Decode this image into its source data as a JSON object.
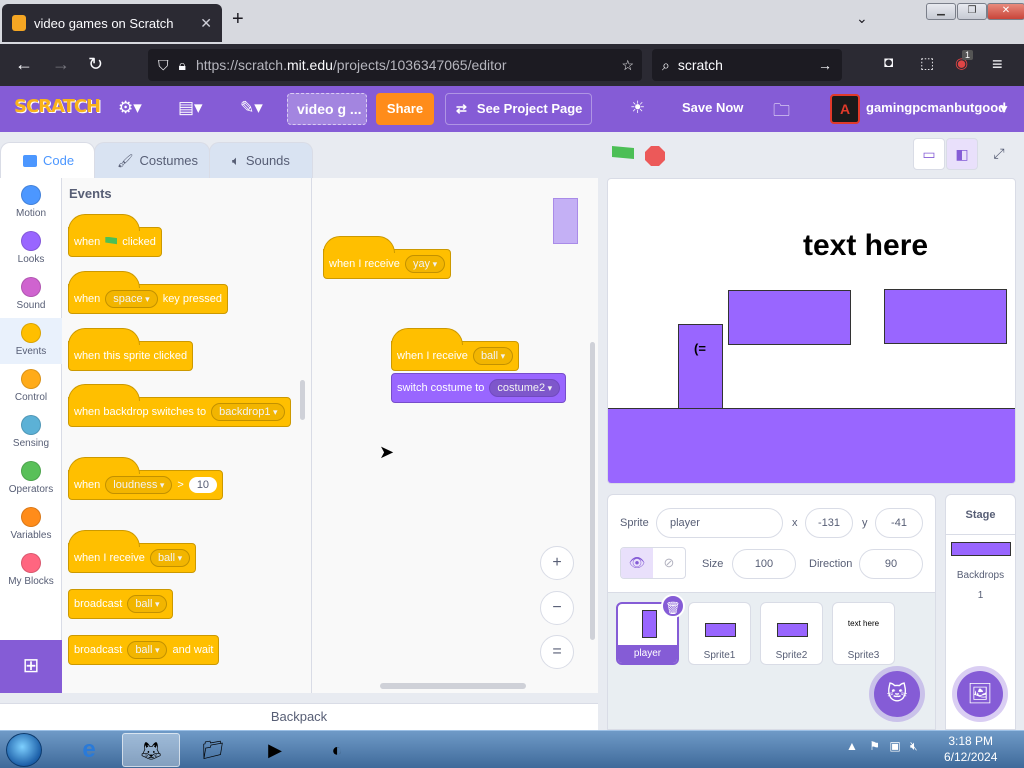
{
  "browser": {
    "tab_title": "video games on Scratch",
    "url_prefix": "https://scratch.",
    "url_host": "mit.edu",
    "url_path": "/projects/1036347065/editor",
    "search_text": "scratch",
    "extension_badge": "1"
  },
  "menubar": {
    "logo": "SCRATCH",
    "project_title": "video g ...",
    "share_label": "Share",
    "project_page_label": "See Project Page",
    "save_now_label": "Save Now",
    "username": "gamingpcmanbutgood",
    "avatar_letter": "A"
  },
  "editor_tabs": [
    {
      "label": "Code",
      "active": true
    },
    {
      "label": "Costumes",
      "active": false
    },
    {
      "label": "Sounds",
      "active": false
    }
  ],
  "categories": [
    {
      "label": "Motion",
      "color": "#4c97ff"
    },
    {
      "label": "Looks",
      "color": "#9966ff"
    },
    {
      "label": "Sound",
      "color": "#cf63cf"
    },
    {
      "label": "Events",
      "color": "#ffbf00"
    },
    {
      "label": "Control",
      "color": "#ffab19"
    },
    {
      "label": "Sensing",
      "color": "#5cb1d6"
    },
    {
      "label": "Operators",
      "color": "#59c059"
    },
    {
      "label": "Variables",
      "color": "#ff8c1a"
    },
    {
      "label": "My Blocks",
      "color": "#ff6680"
    }
  ],
  "palette": {
    "section_title": "Events",
    "blocks": {
      "flag_when": "when",
      "flag_clicked": "clicked",
      "key_when": "when",
      "key_value": "space",
      "key_pressed": "key pressed",
      "sprite_clicked": "when this sprite clicked",
      "backdrop_text": "when backdrop switches to",
      "backdrop_value": "backdrop1",
      "loudness_when": "when",
      "loudness_value": "loudness",
      "loudness_op": ">",
      "loudness_num": "10",
      "receive_text": "when I receive",
      "receive_value": "ball",
      "broadcast_text": "broadcast",
      "broadcast_value": "ball",
      "broadcast_wait_text": "broadcast",
      "broadcast_wait_value": "ball",
      "broadcast_wait_suffix": "and wait"
    }
  },
  "scripts": {
    "script1_text": "when I receive",
    "script1_value": "yay",
    "script2_text": "when I receive",
    "script2_value": "ball",
    "script2_action": "switch costume to",
    "script2_costume": "costume2"
  },
  "zoom": {
    "in": "+",
    "out": "−",
    "reset": "="
  },
  "backpack_label": "Backpack",
  "stage": {
    "text": "text here",
    "player_face": "(="
  },
  "sprite_info": {
    "sprite_label": "Sprite",
    "sprite_name": "player",
    "x_label": "x",
    "x_value": "-131",
    "y_label": "y",
    "y_value": "-41",
    "size_label": "Size",
    "size_value": "100",
    "direction_label": "Direction",
    "direction_value": "90"
  },
  "sprites": [
    {
      "name": "player",
      "selected": true
    },
    {
      "name": "Sprite1",
      "selected": false
    },
    {
      "name": "Sprite2",
      "selected": false
    },
    {
      "name": "Sprite3",
      "selected": false,
      "thumb_text": "text here"
    }
  ],
  "stage_pane": {
    "title": "Stage",
    "backdrops_label": "Backdrops",
    "backdrops_count": "1"
  },
  "taskbar": {
    "time": "3:18 PM",
    "date": "6/12/2024"
  }
}
